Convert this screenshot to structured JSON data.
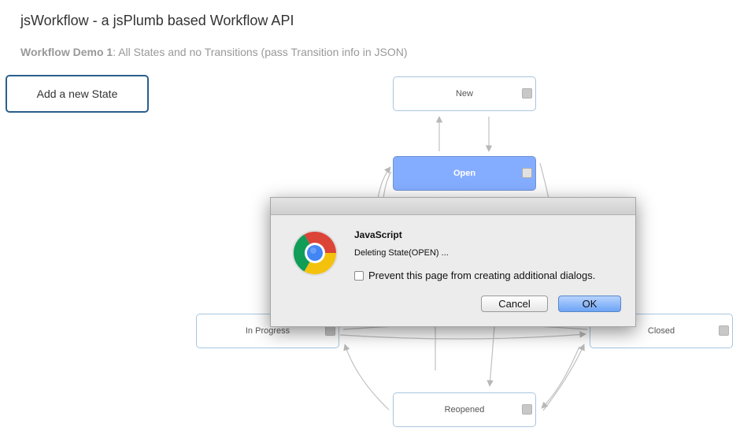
{
  "page": {
    "title": "jsWorkflow - a jsPlumb based Workflow API",
    "subtitle_bold": "Workflow Demo 1",
    "subtitle_rest": ": All States and no Transitions (pass Transition info in JSON)",
    "add_state_label": "Add a new State"
  },
  "states": {
    "new": "New",
    "open": "Open",
    "in_progress": "In Progress",
    "closed": "Closed",
    "reopened": "Reopened"
  },
  "dialog": {
    "heading": "JavaScript",
    "message": "Deleting State(OPEN) ...",
    "checkbox_label": "Prevent this page from creating additional dialogs.",
    "checkbox_checked": false,
    "cancel_label": "Cancel",
    "ok_label": "OK",
    "icon": "chrome-logo-icon"
  },
  "colors": {
    "active_state": "#85adff",
    "state_border": "#a8c6df",
    "button_border": "#2b5f8c",
    "ok_button": "#6da4f5"
  }
}
